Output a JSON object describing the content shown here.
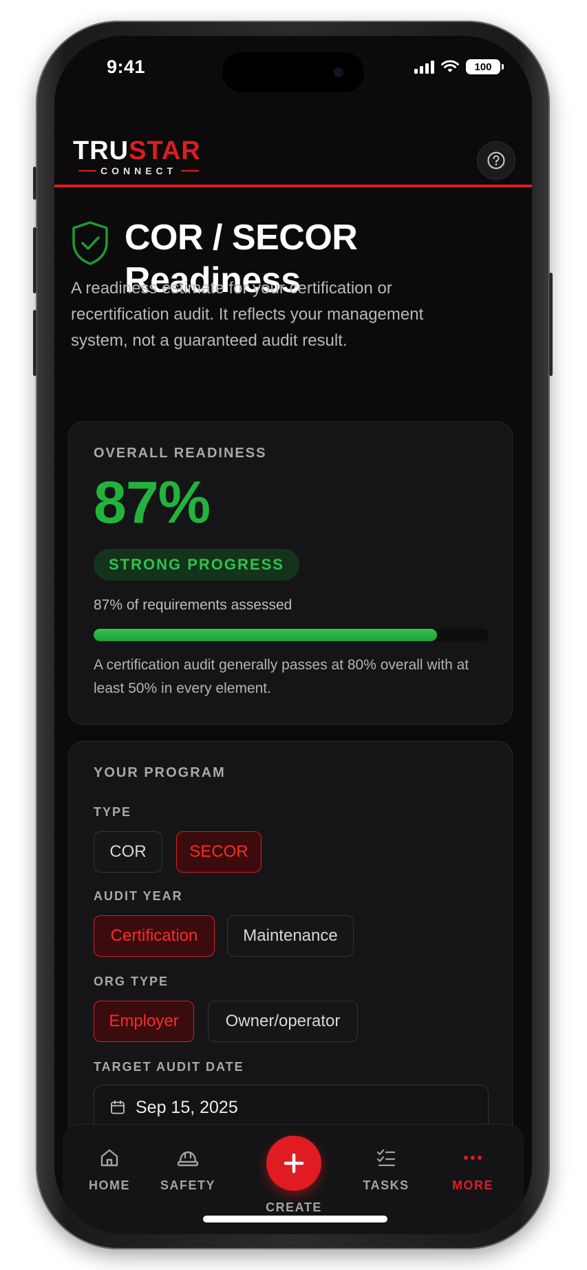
{
  "status": {
    "time": "9:41",
    "battery": "100"
  },
  "header": {
    "logo_tru": "TRU",
    "logo_star": "STAR",
    "logo_sub": "CONNECT",
    "help_icon": "question-circle-icon"
  },
  "page": {
    "title_line1": "COR / SECOR",
    "title_line2": "Readiness",
    "intro": "A readiness estimate for your certification or recertification audit. It reflects your management system, not a guaranteed audit result."
  },
  "readiness": {
    "label": "OVERALL READINESS",
    "percent": "87%",
    "progress": 0.87,
    "badge": "STRONG PROGRESS",
    "assessed": "87% of requirements assessed",
    "note": "A certification audit generally passes at 80% overall with at least 50% in every element."
  },
  "program": {
    "label": "YOUR PROGRAM",
    "type": {
      "label": "TYPE",
      "options": [
        "COR",
        "SECOR"
      ],
      "selected": "SECOR"
    },
    "audit_year": {
      "label": "AUDIT YEAR",
      "options": [
        "Certification",
        "Maintenance"
      ],
      "selected": "Certification"
    },
    "org_type": {
      "label": "ORG TYPE",
      "options": [
        "Employer",
        "Owner/operator"
      ],
      "selected": "Employer"
    },
    "target_date": {
      "label": "TARGET AUDIT DATE",
      "value": "Sep 15, 2025"
    }
  },
  "tabbar": {
    "items": [
      {
        "label": "HOME",
        "icon": "home-icon"
      },
      {
        "label": "SAFETY",
        "icon": "hardhat-icon"
      },
      {
        "label": "CREATE",
        "icon": "plus-icon"
      },
      {
        "label": "TASKS",
        "icon": "checklist-icon"
      },
      {
        "label": "MORE",
        "icon": "more-dots-icon"
      }
    ],
    "active": "MORE"
  },
  "colors": {
    "brand_red": "#e01b22",
    "success_green": "#22b33d",
    "background": "#0b0b0c",
    "card": "#151517"
  }
}
